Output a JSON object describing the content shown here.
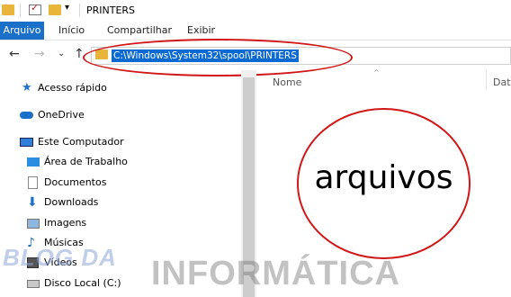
{
  "window": {
    "title": "PRINTERS"
  },
  "ribbon": {
    "tabs": [
      "Arquivo",
      "Início",
      "Compartilhar",
      "Exibir"
    ]
  },
  "address": {
    "path": "C:\\Windows\\System32\\spool\\PRINTERS"
  },
  "sidebar": {
    "items": [
      {
        "label": "Acesso rápido",
        "icon": "star-icon"
      },
      {
        "label": "OneDrive",
        "icon": "cloud-icon"
      },
      {
        "label": "Este Computador",
        "icon": "computer-icon"
      },
      {
        "label": "Área de Trabalho",
        "icon": "desktop-icon"
      },
      {
        "label": "Documentos",
        "icon": "document-icon"
      },
      {
        "label": "Downloads",
        "icon": "download-icon"
      },
      {
        "label": "Imagens",
        "icon": "image-icon"
      },
      {
        "label": "Músicas",
        "icon": "music-icon"
      },
      {
        "label": "Vídeos",
        "icon": "video-icon"
      },
      {
        "label": "Disco Local (C:)",
        "icon": "drive-icon"
      }
    ]
  },
  "content": {
    "columns": [
      "Nome",
      "Data"
    ],
    "annotation": "arquivos"
  },
  "watermark": {
    "line1": "BLOG DA",
    "line2": "INFORMÁTICA"
  },
  "colors": {
    "accent": "#1a6fc9",
    "selection": "#0a6ad1",
    "annotation_red": "#d01616"
  }
}
